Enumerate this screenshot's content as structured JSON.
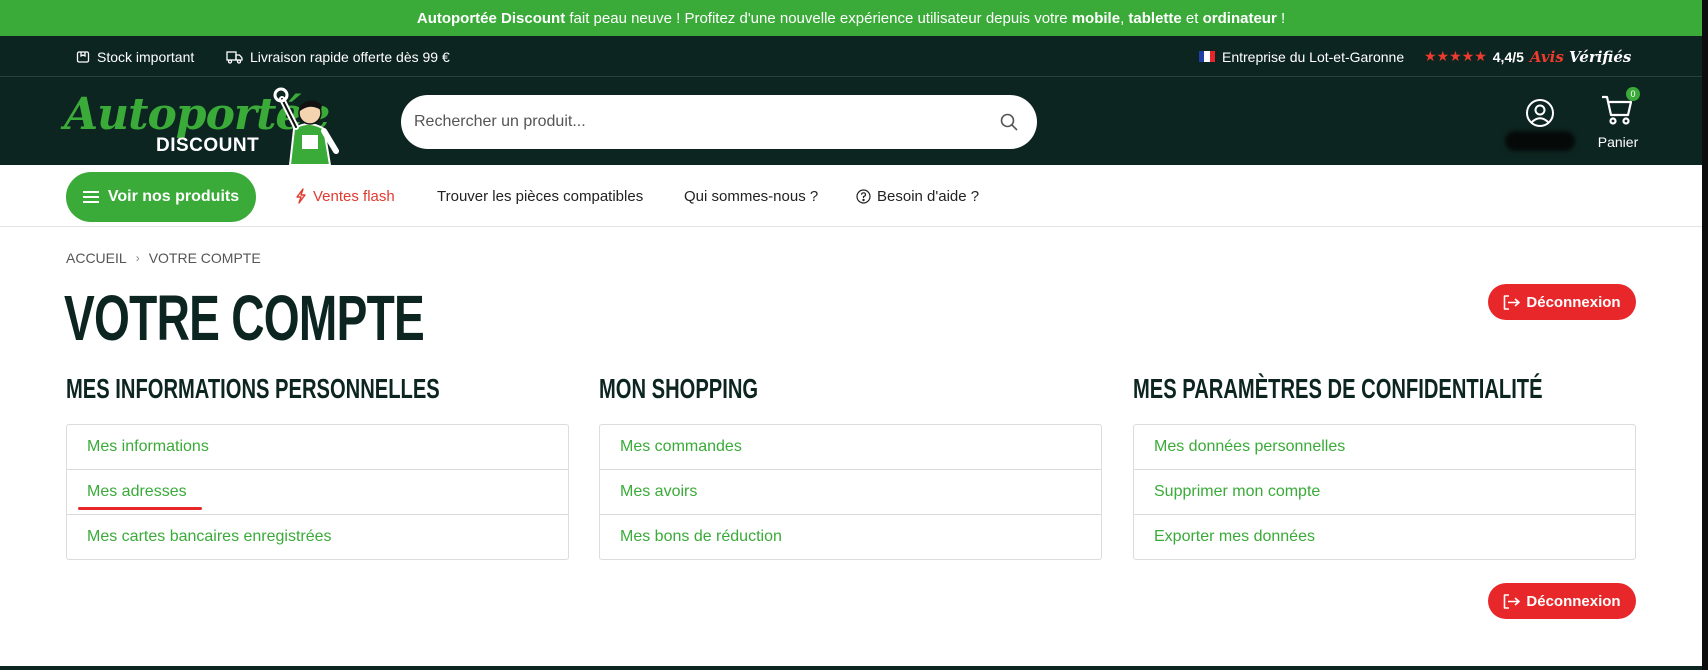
{
  "promo": {
    "brand": "Autoportée Discount",
    "text1": " fait peau neuve ! Profitez d'une nouvelle expérience utilisateur depuis votre ",
    "mobile": "mobile",
    "sep1": ", ",
    "tablet": "tablette",
    "sep2": " et ",
    "computer": "ordinateur",
    "end": " !"
  },
  "topbar": {
    "stock": "Stock important",
    "shipping": "Livraison rapide offerte dès 99 €",
    "company": "Entreprise du Lot-et-Garonne",
    "rating_stars": "★★★★★",
    "rating": "4,4/5",
    "reviews_brand_1": "Avis",
    "reviews_brand_2": " Vérifiés"
  },
  "header": {
    "logo_line1": "Autoportée",
    "logo_line2": "DISCOUNT",
    "search_placeholder": "Rechercher un produit...",
    "cart_label": "Panier",
    "cart_count": "0"
  },
  "nav": {
    "products": "Voir nos produits",
    "flash": "Ventes flash",
    "parts": "Trouver les pièces compatibles",
    "about": "Qui sommes-nous ?",
    "help": "Besoin d'aide ?"
  },
  "breadcrumb": {
    "home": "ACCUEIL",
    "separator": "›",
    "current": "VOTRE COMPTE"
  },
  "page": {
    "title": "VOTRE COMPTE",
    "logout": "Déconnexion"
  },
  "sections": [
    {
      "title": "MES INFORMATIONS PERSONNELLES",
      "items": [
        "Mes informations",
        "Mes adresses",
        "Mes cartes bancaires enregistrées"
      ]
    },
    {
      "title": "MON SHOPPING",
      "items": [
        "Mes commandes",
        "Mes avoirs",
        "Mes bons de réduction"
      ]
    },
    {
      "title": "MES PARAMÈTRES DE CONFIDENTIALITÉ",
      "items": [
        "Mes données personnelles",
        "Supprimer mon compte",
        "Exporter mes données"
      ]
    }
  ],
  "colors": {
    "brand_green": "#3aab38",
    "dark_header": "#0d2520",
    "logout_red": "#e8272a",
    "flash_red": "#e03a2f"
  },
  "icons": {
    "stock": "box-icon",
    "shipping": "truck-icon",
    "search": "search-icon",
    "account": "user-circle-icon",
    "cart": "cart-icon",
    "menu": "hamburger-icon",
    "flash": "lightning-icon",
    "help": "question-circle-icon",
    "logout": "logout-icon"
  }
}
